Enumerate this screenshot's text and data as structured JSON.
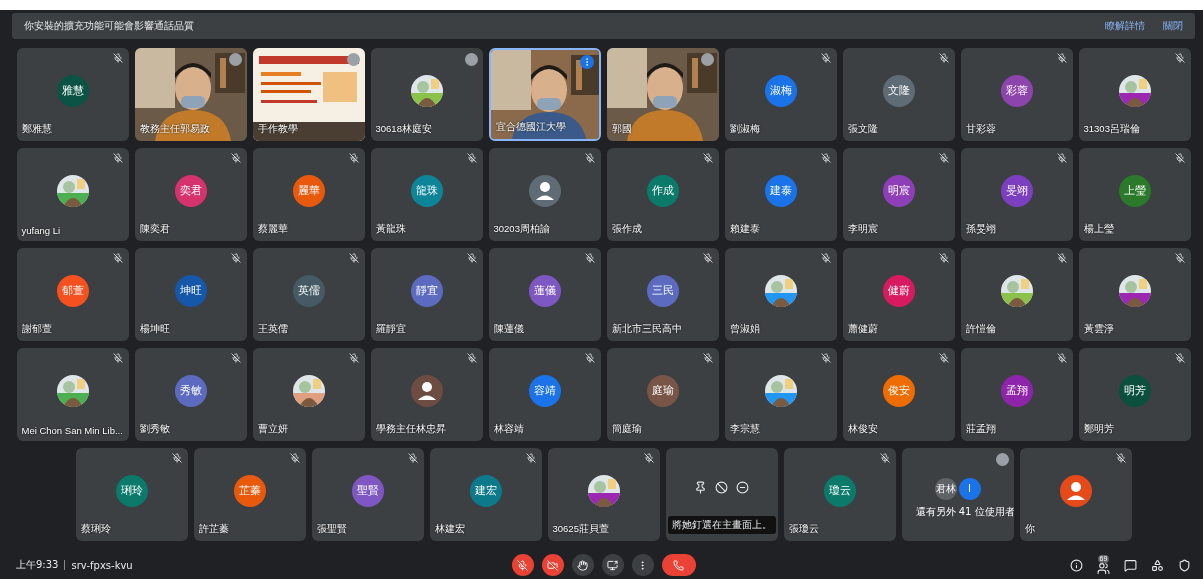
{
  "banner": {
    "message": "你安裝的擴充功能可能會影響通話品質",
    "links": [
      "瞭解詳情",
      "關閉"
    ]
  },
  "rows": [
    [
      {
        "kind": "avatar",
        "initials": "雅慧",
        "color": "#0b5345",
        "name": "鄭雅慧",
        "muted": true,
        "speaking": false
      },
      {
        "kind": "video",
        "name": "教務主任郭易政",
        "muted": false,
        "speaking": false
      },
      {
        "kind": "slides",
        "name": "手作教學",
        "muted": false,
        "speaking": false
      },
      {
        "name": "30618林庭安",
        "muted": false,
        "speaking": false
      },
      {
        "kind": "video",
        "name": "宜合德國江大學",
        "muted": false,
        "speaking": true
      },
      {
        "kind": "video",
        "name": "郭國",
        "muted": false,
        "speaking": false
      },
      {
        "kind": "avatar",
        "initials": "淑梅",
        "color": "#1a73e8",
        "name": "劉淑梅",
        "muted": true,
        "speaking": false
      },
      {
        "kind": "avatar",
        "initials": "文隆",
        "color": "#5f6b75",
        "name": "張文隆",
        "muted": true,
        "speaking": false
      },
      {
        "kind": "avatar",
        "initials": "彩蓉",
        "color": "#8e44ad",
        "name": "甘彩蓉",
        "muted": true,
        "speaking": false
      },
      {
        "name": "31303呂瑞倫",
        "muted": true,
        "speaking": false
      }
    ],
    [
      {
        "name": "yufang Li",
        "muted": true,
        "speaking": false
      },
      {
        "kind": "avatar",
        "initials": "奕君",
        "color": "#d6336c",
        "name": "陳奕君",
        "muted": true,
        "speaking": false
      },
      {
        "kind": "avatar",
        "initials": "麗華",
        "color": "#e8590c",
        "name": "蔡麗華",
        "muted": true,
        "speaking": false
      },
      {
        "kind": "avatar",
        "initials": "龍珠",
        "color": "#0c8599",
        "name": "黃龍珠",
        "muted": true,
        "speaking": false
      },
      {
        "kind": "silhouette",
        "color": "#5f6b75",
        "name": "30203周柏諭",
        "muted": true,
        "speaking": false
      },
      {
        "kind": "avatar",
        "initials": "作成",
        "color": "#0b7a6b",
        "name": "張作成",
        "muted": true,
        "speaking": false
      },
      {
        "kind": "avatar",
        "initials": "建泰",
        "color": "#1a73e8",
        "name": "賴建泰",
        "muted": true,
        "speaking": false
      },
      {
        "kind": "avatar",
        "initials": "明宸",
        "color": "#8e3fb8",
        "name": "李明宸",
        "muted": true,
        "speaking": false
      },
      {
        "kind": "avatar",
        "initials": "旻翊",
        "color": "#7b3fbf",
        "name": "孫旻翊",
        "muted": true,
        "speaking": false
      },
      {
        "kind": "avatar",
        "initials": "上瑩",
        "color": "#2b7a2b",
        "name": "楊上瑩",
        "muted": true,
        "speaking": false
      }
    ],
    [
      {
        "kind": "avatar",
        "initials": "郁萱",
        "color": "#f4511e",
        "name": "謝郁萱",
        "muted": true,
        "speaking": false
      },
      {
        "kind": "avatar",
        "initials": "坤旺",
        "color": "#1557a8",
        "name": "楊坤旺",
        "muted": true,
        "speaking": false
      },
      {
        "kind": "avatar",
        "initials": "英儒",
        "color": "#455a64",
        "name": "王英儒",
        "muted": true,
        "speaking": false
      },
      {
        "kind": "avatar",
        "initials": "靜宜",
        "color": "#5c6bc0",
        "name": "羅靜宜",
        "muted": true,
        "speaking": false
      },
      {
        "kind": "avatar",
        "initials": "蓮儀",
        "color": "#7e57c2",
        "name": "陳蓮儀",
        "muted": true,
        "speaking": false
      },
      {
        "kind": "avatar",
        "initials": "三民",
        "color": "#5c6bc0",
        "name": "新北市三民高中",
        "muted": true,
        "speaking": false
      },
      {
        "name": "曾淑娟",
        "muted": true,
        "speaking": false
      },
      {
        "kind": "avatar",
        "initials": "健蔚",
        "color": "#d81b60",
        "name": "蕭健蔚",
        "muted": true,
        "speaking": false
      },
      {
        "name": "許愷倫",
        "muted": true,
        "speaking": false
      },
      {
        "name": "黃雲淨",
        "muted": true,
        "speaking": false
      }
    ],
    [
      {
        "name": "Mei Chon San Min Lib...",
        "muted": true,
        "speaking": false
      },
      {
        "kind": "avatar",
        "initials": "秀敏",
        "color": "#5c6bc0",
        "name": "劉秀敏",
        "muted": true,
        "speaking": false
      },
      {
        "name": "曹立妍",
        "muted": true,
        "speaking": false
      },
      {
        "kind": "silhouette",
        "color": "#6d4c41",
        "name": "學務主任林忠昇",
        "muted": true,
        "speaking": false
      },
      {
        "kind": "avatar",
        "initials": "容靖",
        "color": "#1a73e8",
        "name": "林容靖",
        "muted": true,
        "speaking": false
      },
      {
        "kind": "avatar",
        "initials": "庭瑜",
        "color": "#795548",
        "name": "簡庭瑜",
        "muted": true,
        "speaking": false
      },
      {
        "name": "李宗慧",
        "muted": true,
        "speaking": false
      },
      {
        "kind": "avatar",
        "initials": "俊安",
        "color": "#ef6c00",
        "name": "林俊安",
        "muted": true,
        "speaking": false
      },
      {
        "kind": "avatar",
        "initials": "孟翔",
        "color": "#8e24aa",
        "name": "莊孟翔",
        "muted": true,
        "speaking": false
      },
      {
        "kind": "avatar",
        "initials": "明芳",
        "color": "#0b4f3f",
        "name": "鄭明芳",
        "muted": true,
        "speaking": false
      }
    ],
    [
      {
        "kind": "avatar",
        "initials": "琍玲",
        "color": "#0b7a6b",
        "name": "蔡琍玲",
        "muted": true,
        "speaking": false
      },
      {
        "kind": "avatar",
        "initials": "芷蓁",
        "color": "#e8590c",
        "name": "許芷蓁",
        "muted": true,
        "speaking": false
      },
      {
        "kind": "avatar",
        "initials": "聖賢",
        "color": "#7e57c2",
        "name": "張聖賢",
        "muted": true,
        "speaking": false
      },
      {
        "kind": "avatar",
        "initials": "建宏",
        "color": "#0c7a8a",
        "name": "林建宏",
        "muted": true,
        "speaking": false
      },
      {
        "name": "30625莊貝萱",
        "muted": true,
        "speaking": false
      },
      {
        "kind": "hover",
        "tooltip": "將她釘選在主畫面上。",
        "speaking": false
      },
      {
        "kind": "avatar",
        "initials": "瓊云",
        "color": "#0b7a6b",
        "name": "張瓊云",
        "muted": true,
        "speaking": false
      },
      {
        "kind": "others",
        "chips": [
          "君林",
          "I"
        ],
        "name": "還有另外 41 位使用者",
        "muted": false,
        "speaking": false
      },
      {
        "kind": "silhouette",
        "color": "#e64a19",
        "name": "你",
        "muted": true,
        "speaking": false
      }
    ]
  ],
  "bottom": {
    "time": "上午9:33",
    "code": "srv-fpxs-kvu",
    "controls": [
      {
        "kind": "mic",
        "off": true
      },
      {
        "kind": "camera",
        "off": true
      },
      {
        "kind": "hand",
        "off": false
      },
      {
        "kind": "present",
        "off": false
      },
      {
        "kind": "more",
        "off": false
      },
      {
        "kind": "hangup",
        "off": true
      }
    ],
    "people_count": "69"
  }
}
